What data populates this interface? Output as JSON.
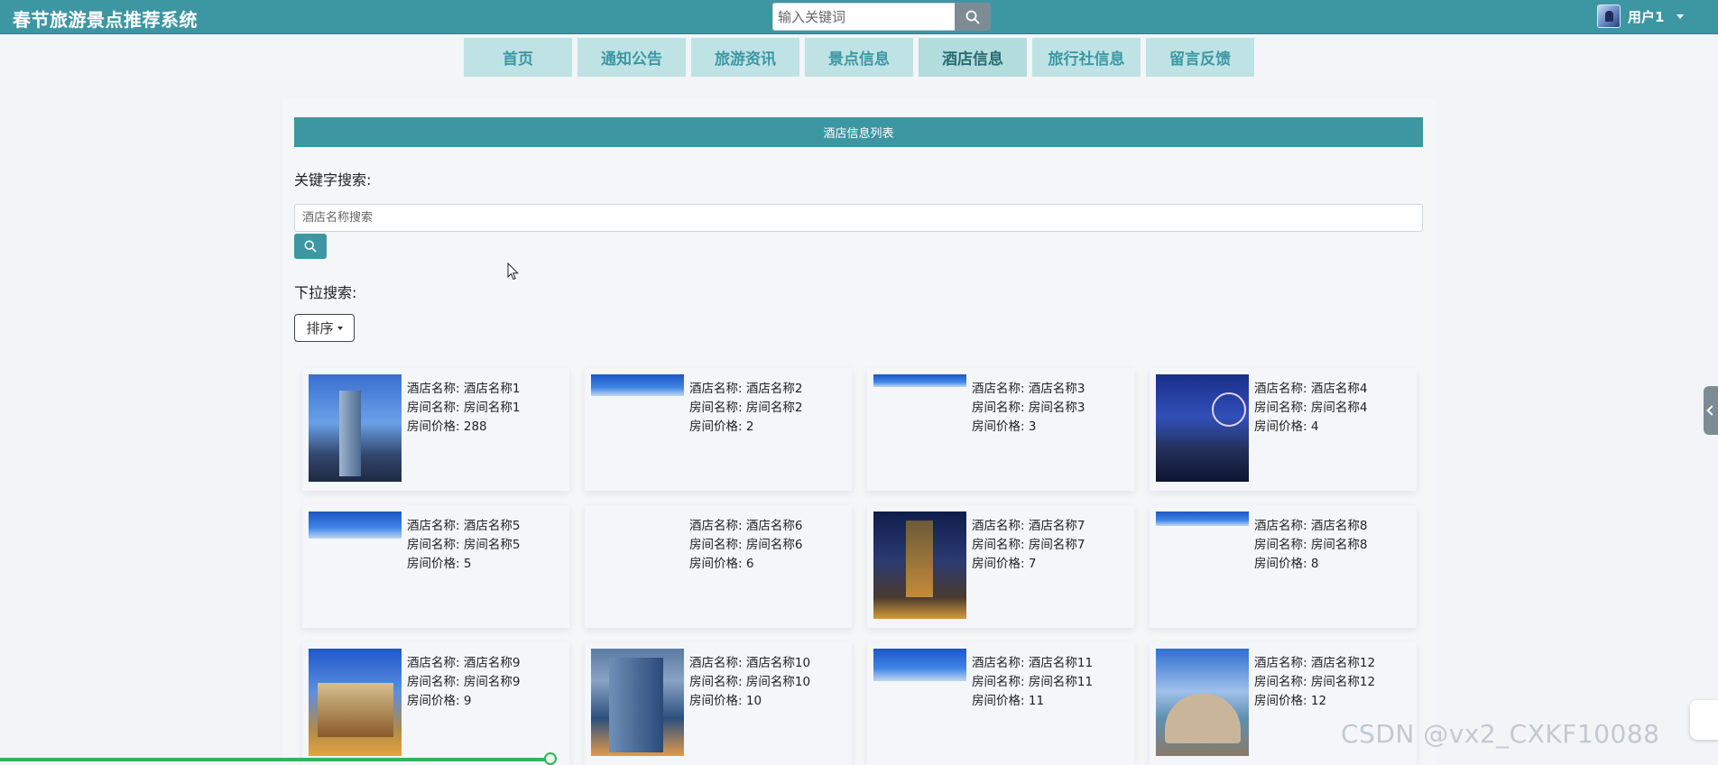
{
  "header": {
    "site_title": "春节旅游景点推荐系统",
    "search_placeholder": "输入关键词",
    "user_name": "用户1"
  },
  "nav": {
    "items": [
      "首页",
      "通知公告",
      "旅游资讯",
      "景点信息",
      "酒店信息",
      "旅行社信息",
      "留言反馈"
    ],
    "active": "酒店信息"
  },
  "main": {
    "list_title": "酒店信息列表",
    "keyword_label": "关键字搜索:",
    "keyword_placeholder": "酒店名称搜索",
    "dropdown_label": "下拉搜索:",
    "sort_label": "排序"
  },
  "field_labels": {
    "hotel_name": "酒店名称:",
    "room_name": "房间名称:",
    "room_price": "房间价格:"
  },
  "hotels": [
    {
      "hotel": "酒店名称1",
      "room": "房间名称1",
      "price": "288"
    },
    {
      "hotel": "酒店名称2",
      "room": "房间名称2",
      "price": "2"
    },
    {
      "hotel": "酒店名称3",
      "room": "房间名称3",
      "price": "3"
    },
    {
      "hotel": "酒店名称4",
      "room": "房间名称4",
      "price": "4"
    },
    {
      "hotel": "酒店名称5",
      "room": "房间名称5",
      "price": "5"
    },
    {
      "hotel": "酒店名称6",
      "room": "房间名称6",
      "price": "6"
    },
    {
      "hotel": "酒店名称7",
      "room": "房间名称7",
      "price": "7"
    },
    {
      "hotel": "酒店名称8",
      "room": "房间名称8",
      "price": "8"
    },
    {
      "hotel": "酒店名称9",
      "room": "房间名称9",
      "price": "9"
    },
    {
      "hotel": "酒店名称10",
      "room": "房间名称10",
      "price": "10"
    },
    {
      "hotel": "酒店名称11",
      "room": "房间名称11",
      "price": "11"
    },
    {
      "hotel": "酒店名称12",
      "room": "房间名称12",
      "price": "12"
    }
  ],
  "watermark": "CSDN @vx2_CXKF10088"
}
